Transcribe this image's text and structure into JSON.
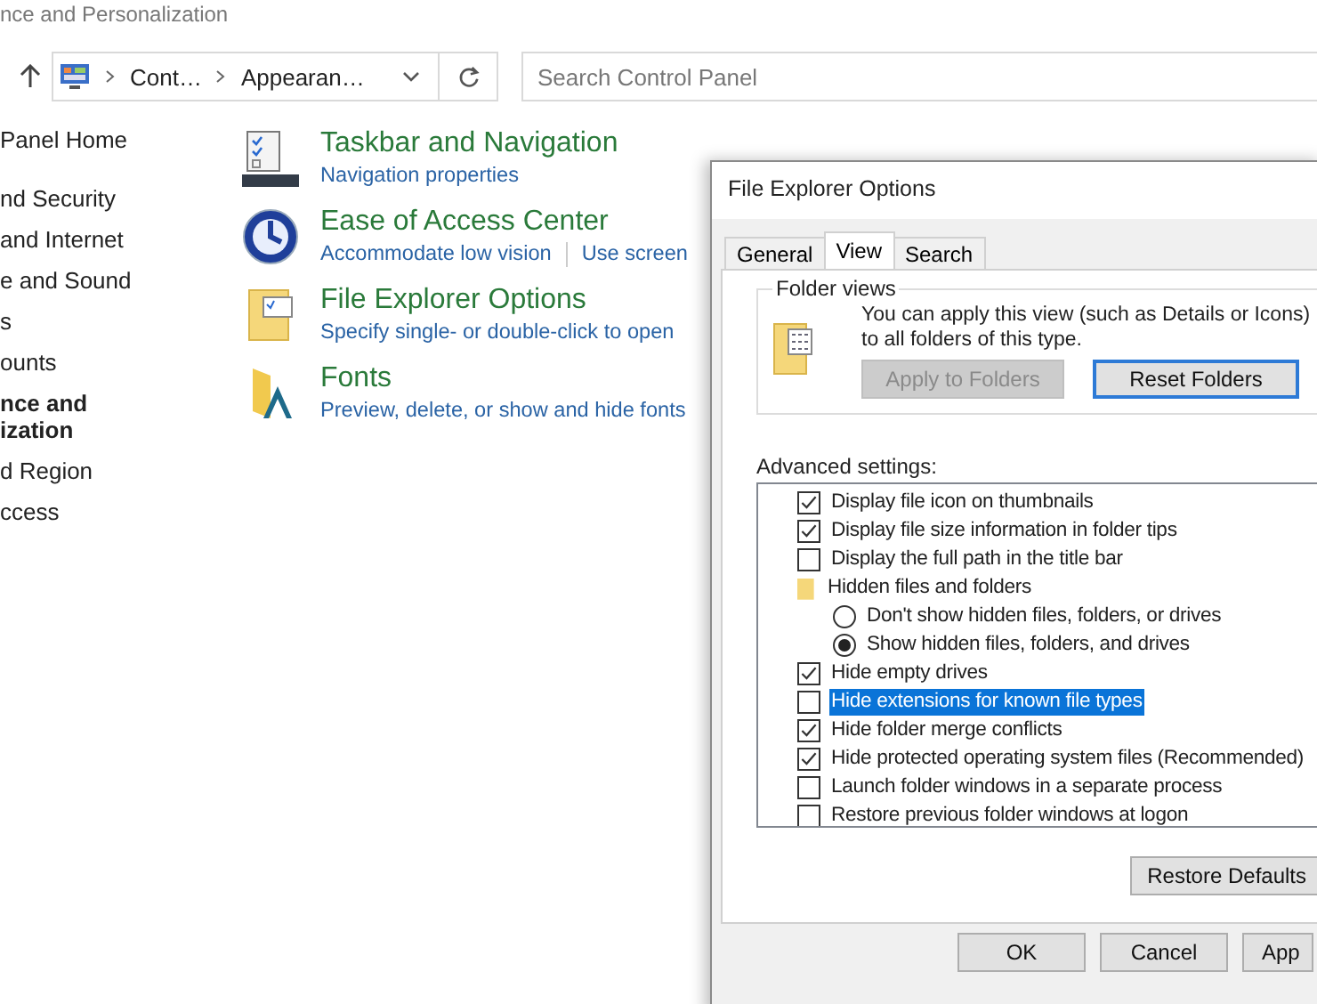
{
  "window": {
    "title": "nce and Personalization"
  },
  "address_bar": {
    "crumbs": [
      "Cont…",
      "Appearan…"
    ]
  },
  "search": {
    "placeholder": "Search Control Panel"
  },
  "sidebar": {
    "items": [
      {
        "label": "Panel Home",
        "selected": false
      },
      {
        "label": "nd Security",
        "selected": false
      },
      {
        "label": "and Internet",
        "selected": false
      },
      {
        "label": "e and Sound",
        "selected": false
      },
      {
        "label": "s",
        "selected": false
      },
      {
        "label": "ounts",
        "selected": false
      },
      {
        "label": "nce and\nization",
        "selected": true
      },
      {
        "label": "d Region",
        "selected": false
      },
      {
        "label": "ccess",
        "selected": false
      }
    ]
  },
  "categories": [
    {
      "kind": "taskbar",
      "title": "Taskbar and Navigation",
      "links": [
        "Navigation properties"
      ]
    },
    {
      "kind": "access",
      "title": "Ease of Access Center",
      "links": [
        "Accommodate low vision",
        "Use screen"
      ]
    },
    {
      "kind": "folder",
      "title": "File Explorer Options",
      "links": [
        "Specify single- or double-click to open"
      ]
    },
    {
      "kind": "fonts",
      "title": "Fonts",
      "links": [
        "Preview, delete, or show and hide fonts"
      ]
    }
  ],
  "dialog": {
    "title": "File Explorer Options",
    "tabs": [
      {
        "label": "General",
        "selected": false
      },
      {
        "label": "View",
        "selected": true
      },
      {
        "label": "Search",
        "selected": false
      }
    ],
    "folder_views": {
      "legend": "Folder views",
      "description": "You can apply this view (such as Details or Icons) to all folders of this type.",
      "buttons": [
        {
          "label": "Apply to Folders",
          "disabled": true,
          "focused": false
        },
        {
          "label": "Reset Folders",
          "disabled": false,
          "focused": true
        }
      ]
    },
    "advanced_label": "Advanced settings:",
    "settings": [
      {
        "kind": "checkbox",
        "label": "Display file icon on thumbnails",
        "checked": true,
        "selected": false
      },
      {
        "kind": "checkbox",
        "label": "Display file size information in folder tips",
        "checked": true,
        "selected": false
      },
      {
        "kind": "checkbox",
        "label": "Display the full path in the title bar",
        "checked": false,
        "selected": false
      },
      {
        "kind": "group",
        "label": "Hidden files and folders",
        "selected": false,
        "children": [
          {
            "kind": "radio",
            "label": "Don't show hidden files, folders, or drives",
            "checked": false,
            "selected": false
          },
          {
            "kind": "radio",
            "label": "Show hidden files, folders, and drives",
            "checked": true,
            "selected": false
          }
        ]
      },
      {
        "kind": "checkbox",
        "label": "Hide empty drives",
        "checked": true,
        "selected": false
      },
      {
        "kind": "checkbox",
        "label": "Hide extensions for known file types",
        "checked": false,
        "selected": true
      },
      {
        "kind": "checkbox",
        "label": "Hide folder merge conflicts",
        "checked": true,
        "selected": false
      },
      {
        "kind": "checkbox",
        "label": "Hide protected operating system files (Recommended)",
        "checked": true,
        "selected": false
      },
      {
        "kind": "checkbox",
        "label": "Launch folder windows in a separate process",
        "checked": false,
        "selected": false
      },
      {
        "kind": "checkbox",
        "label": "Restore previous folder windows at logon",
        "checked": false,
        "selected": false
      }
    ],
    "restore_button": "Restore Defaults",
    "buttons": [
      "OK",
      "Cancel",
      "App"
    ]
  }
}
